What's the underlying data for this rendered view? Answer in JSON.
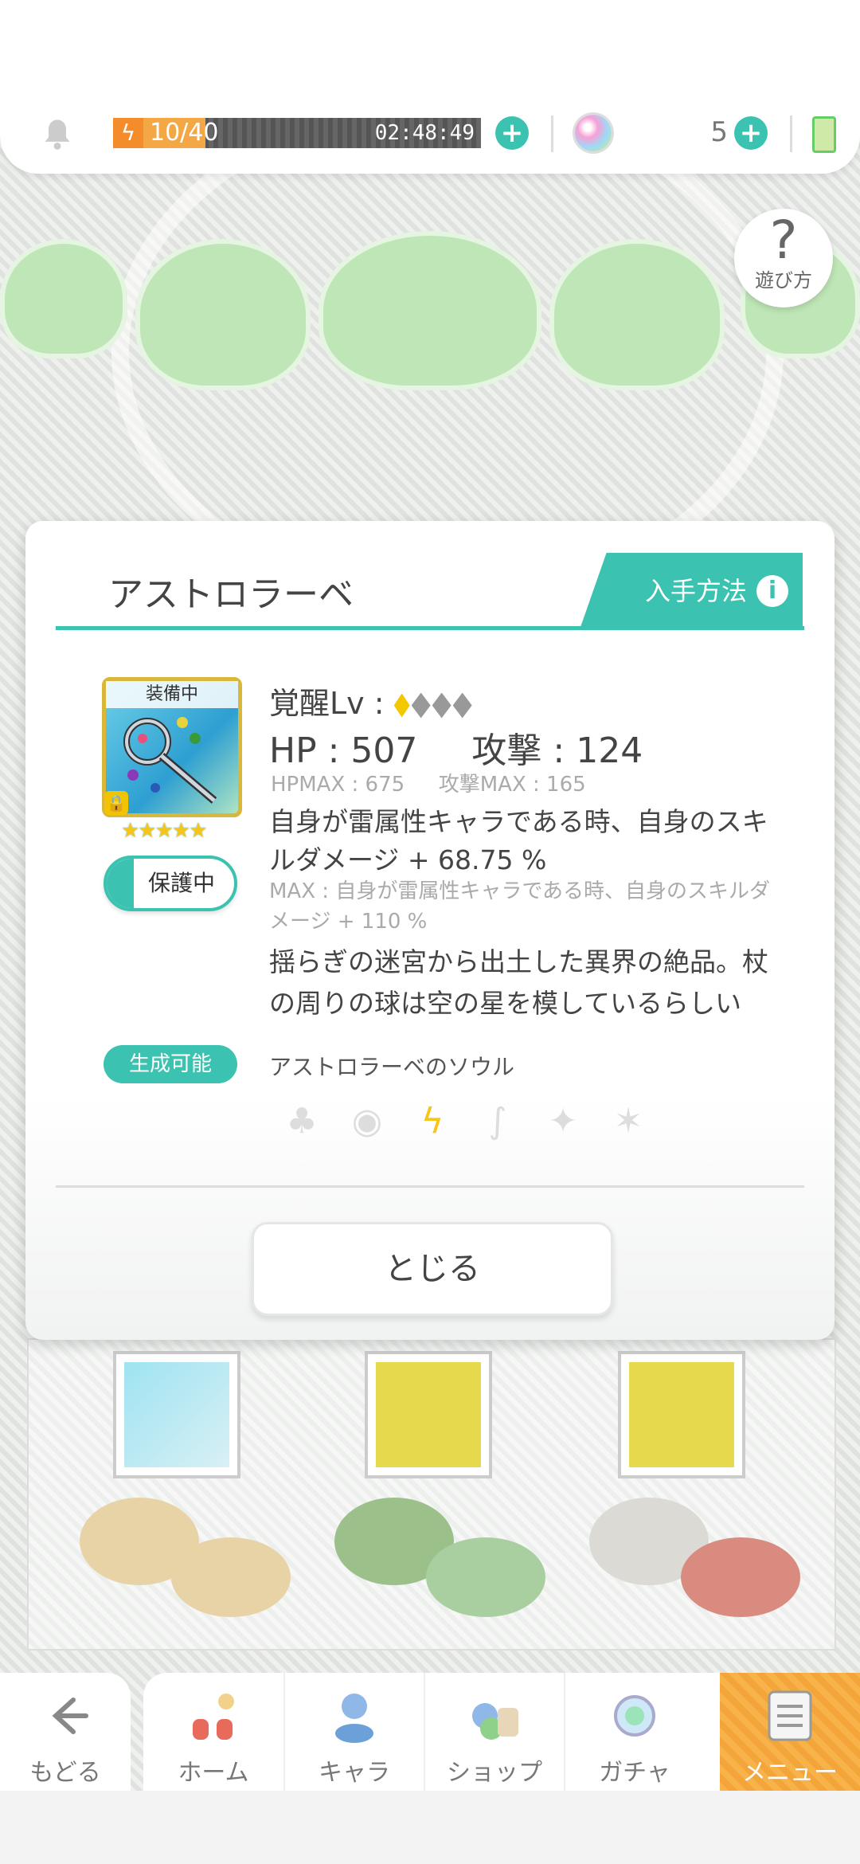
{
  "status_bar": {
    "stamina_text": "10/40",
    "stamina_fraction": 0.25,
    "timer": "02:48:49",
    "gem_count": "5"
  },
  "help": {
    "label": "遊び方",
    "glyph": "?"
  },
  "dialog": {
    "title": "アストロラーベ",
    "acquire_label": "入手方法",
    "equip_label": "装備中",
    "stars": "★★★★★",
    "protect_label": "保護中",
    "awaken_label": "覚醒Lv :",
    "hp_label": "HP : 507",
    "atk_label": "攻撃 : 124",
    "hpmax_label": "HPMAX : 675",
    "atkmax_label": "攻撃MAX : 165",
    "skill": "自身が雷属性キャラである時、自身のスキルダメージ + 68.75 %",
    "skill_max": "MAX : 自身が雷属性キャラである時、自身のスキルダメージ + 110 %",
    "flavor": "揺らぎの迷宮から出土した異界の絶品。杖の周りの球は空の星を模しているらしい",
    "craft_badge": "生成可能",
    "soul": "アストロラーベのソウル",
    "close_label": "とじる"
  },
  "elements": [
    {
      "name": "earth",
      "glyph": "♣",
      "active": false
    },
    {
      "name": "water",
      "glyph": "◉",
      "active": false
    },
    {
      "name": "thunder",
      "glyph": "ϟ",
      "active": true
    },
    {
      "name": "wind",
      "glyph": "∫",
      "active": false
    },
    {
      "name": "light",
      "glyph": "✦",
      "active": false
    },
    {
      "name": "dark",
      "glyph": "✶",
      "active": false
    }
  ],
  "nav": {
    "back_label": "もどる",
    "items": [
      {
        "label": "ホーム",
        "icon": "home-icon"
      },
      {
        "label": "キャラ",
        "icon": "character-icon"
      },
      {
        "label": "ショップ",
        "icon": "shop-icon"
      },
      {
        "label": "ガチャ",
        "icon": "gacha-icon"
      },
      {
        "label": "メニュー",
        "icon": "menu-icon",
        "active": true
      }
    ]
  },
  "colors": {
    "accent": "#3cc2b0",
    "active_tab": "#f7b34a",
    "gold": "#f5c518"
  }
}
